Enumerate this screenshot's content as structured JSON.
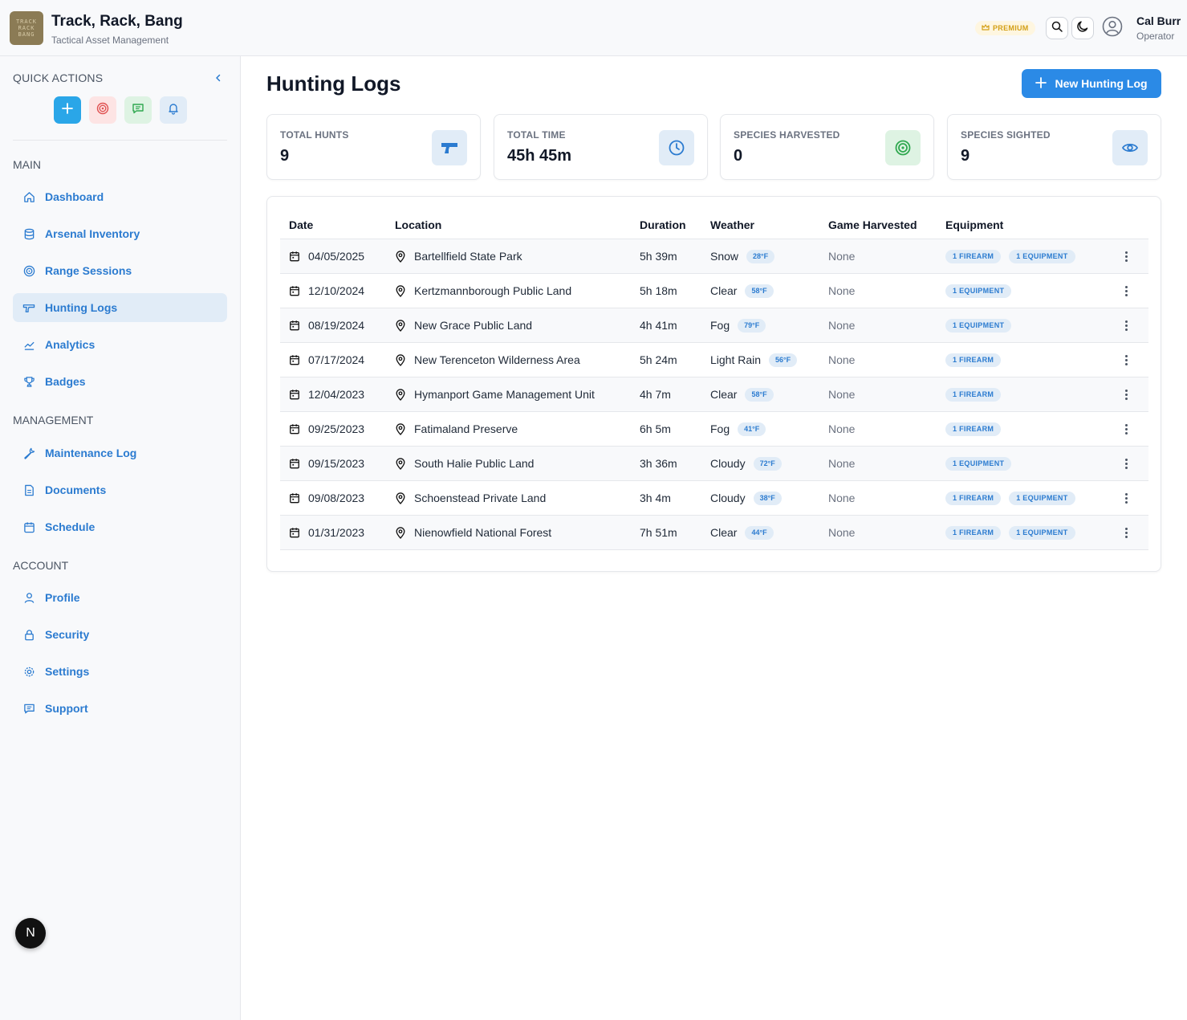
{
  "header": {
    "logo_lines": [
      "TRACK",
      "RACK",
      "BANG"
    ],
    "title": "Track, Rack, Bang",
    "subtitle": "Tactical Asset Management",
    "premium_label": "PREMIUM",
    "user_name": "Cal Burr",
    "user_role": "Operator"
  },
  "sidebar": {
    "quick_actions_title": "QUICK ACTIONS",
    "sections": {
      "main": "MAIN",
      "management": "MANAGEMENT",
      "account": "ACCOUNT"
    },
    "main_items": [
      {
        "label": "Dashboard",
        "icon": "home-icon"
      },
      {
        "label": "Arsenal Inventory",
        "icon": "database-icon"
      },
      {
        "label": "Range Sessions",
        "icon": "target-icon"
      },
      {
        "label": "Hunting Logs",
        "icon": "gun-icon",
        "active": true
      },
      {
        "label": "Analytics",
        "icon": "chart-icon"
      },
      {
        "label": "Badges",
        "icon": "trophy-icon"
      }
    ],
    "management_items": [
      {
        "label": "Maintenance Log",
        "icon": "wrench-icon"
      },
      {
        "label": "Documents",
        "icon": "document-icon"
      },
      {
        "label": "Schedule",
        "icon": "calendar-icon"
      }
    ],
    "account_items": [
      {
        "label": "Profile",
        "icon": "user-icon"
      },
      {
        "label": "Security",
        "icon": "lock-icon"
      },
      {
        "label": "Settings",
        "icon": "gear-icon"
      },
      {
        "label": "Support",
        "icon": "message-icon"
      }
    ],
    "floating_badge": "N"
  },
  "page": {
    "title": "Hunting Logs",
    "new_button_label": "New Hunting Log"
  },
  "stats": [
    {
      "label": "TOTAL HUNTS",
      "value": "9",
      "icon": "gun-icon"
    },
    {
      "label": "TOTAL TIME",
      "value": "45h 45m",
      "icon": "clock-icon"
    },
    {
      "label": "SPECIES HARVESTED",
      "value": "0",
      "icon": "target-icon"
    },
    {
      "label": "SPECIES SIGHTED",
      "value": "9",
      "icon": "eye-icon"
    }
  ],
  "table": {
    "headers": [
      "Date",
      "Location",
      "Duration",
      "Weather",
      "Game Harvested",
      "Equipment"
    ],
    "rows": [
      {
        "date": "04/05/2025",
        "location": "Bartellfield State Park",
        "duration": "5h 39m",
        "weather": "Snow",
        "temp": "28°F",
        "game": "None",
        "equipment": [
          "1 FIREARM",
          "1 EQUIPMENT"
        ]
      },
      {
        "date": "12/10/2024",
        "location": "Kertzmannborough Public Land",
        "duration": "5h 18m",
        "weather": "Clear",
        "temp": "58°F",
        "game": "None",
        "equipment": [
          "1 EQUIPMENT"
        ]
      },
      {
        "date": "08/19/2024",
        "location": "New Grace Public Land",
        "duration": "4h 41m",
        "weather": "Fog",
        "temp": "79°F",
        "game": "None",
        "equipment": [
          "1 EQUIPMENT"
        ]
      },
      {
        "date": "07/17/2024",
        "location": "New Terenceton Wilderness Area",
        "duration": "5h 24m",
        "weather": "Light Rain",
        "temp": "56°F",
        "game": "None",
        "equipment": [
          "1 FIREARM"
        ]
      },
      {
        "date": "12/04/2023",
        "location": "Hymanport Game Management Unit",
        "duration": "4h 7m",
        "weather": "Clear",
        "temp": "58°F",
        "game": "None",
        "equipment": [
          "1 FIREARM"
        ]
      },
      {
        "date": "09/25/2023",
        "location": "Fatimaland Preserve",
        "duration": "6h 5m",
        "weather": "Fog",
        "temp": "41°F",
        "game": "None",
        "equipment": [
          "1 FIREARM"
        ]
      },
      {
        "date": "09/15/2023",
        "location": "South Halie Public Land",
        "duration": "3h 36m",
        "weather": "Cloudy",
        "temp": "72°F",
        "game": "None",
        "equipment": [
          "1 EQUIPMENT"
        ]
      },
      {
        "date": "09/08/2023",
        "location": "Schoenstead Private Land",
        "duration": "3h 4m",
        "weather": "Cloudy",
        "temp": "38°F",
        "game": "None",
        "equipment": [
          "1 FIREARM",
          "1 EQUIPMENT"
        ]
      },
      {
        "date": "01/31/2023",
        "location": "Nienowfield National Forest",
        "duration": "7h 51m",
        "weather": "Clear",
        "temp": "44°F",
        "game": "None",
        "equipment": [
          "1 FIREARM",
          "1 EQUIPMENT"
        ]
      }
    ]
  },
  "colors": {
    "accent": "#2b7bd0",
    "primary_button": "#2b8ae6",
    "active_nav_bg": "#e1ecf7",
    "premium": "#d4a017"
  }
}
